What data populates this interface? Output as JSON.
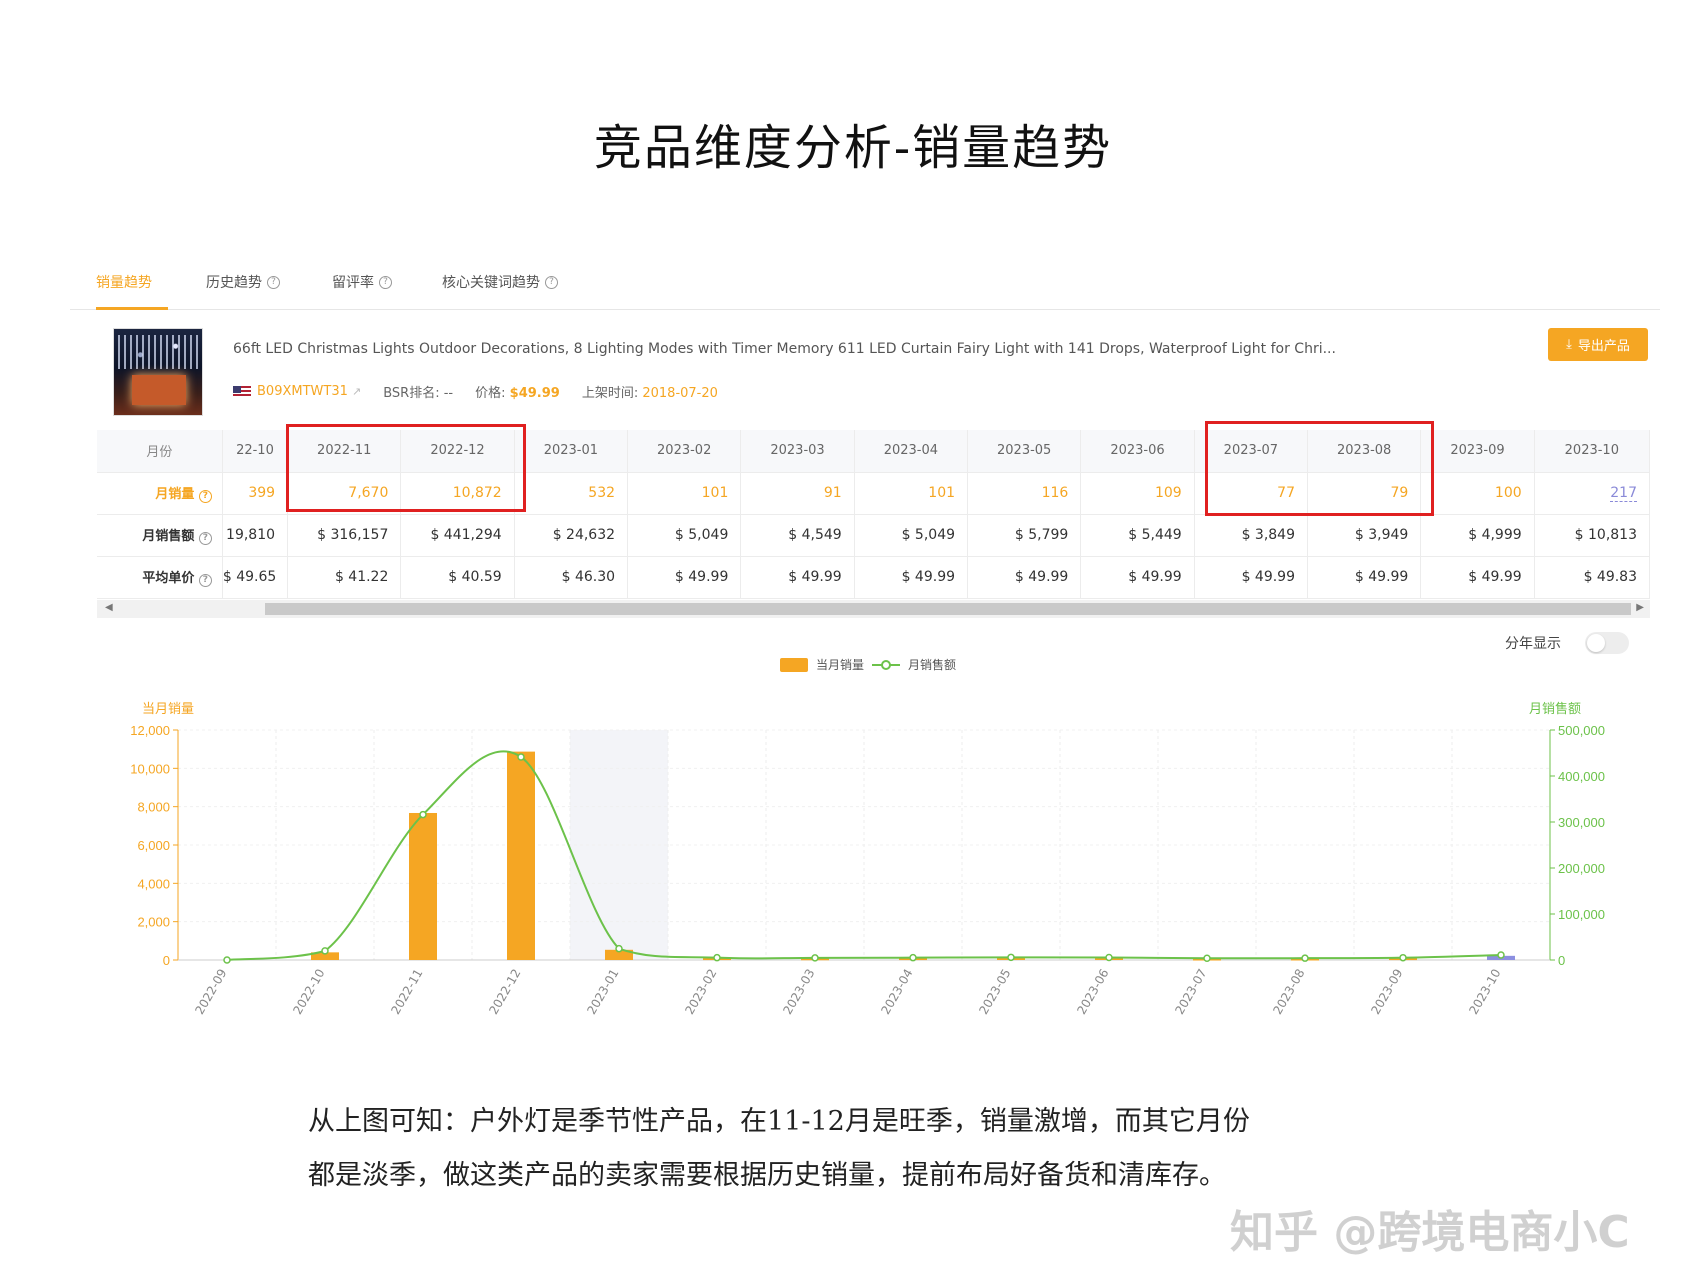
{
  "page_title": "竞品维度分析-销量趋势",
  "tabs": [
    {
      "label": "销量趋势"
    },
    {
      "label": "历史趋势"
    },
    {
      "label": "留评率"
    },
    {
      "label": "核心关键词趋势"
    }
  ],
  "product": {
    "title": "66ft LED Christmas Lights Outdoor Decorations, 8 Lighting Modes with Timer Memory 611 LED Curtain Fairy Light with 141 Drops, Waterproof Light for Chri...",
    "asin": "B09XMTWT31",
    "bsr_label": "BSR排名:",
    "bsr_value": "--",
    "price_label": "价格:",
    "price_value": "$49.99",
    "listed_label": "上架时间:",
    "listed_value": "2018-07-20",
    "export_label": "导出产品"
  },
  "table": {
    "row_labels": {
      "month": "月份",
      "sales": "月销量",
      "revenue": "月销售额",
      "avg_price": "平均单价"
    },
    "months": [
      "22-10",
      "2022-11",
      "2022-12",
      "2023-01",
      "2023-02",
      "2023-03",
      "2023-04",
      "2023-05",
      "2023-06",
      "2023-07",
      "2023-08",
      "2023-09",
      "2023-10"
    ],
    "sales": [
      "399",
      "7,670",
      "10,872",
      "532",
      "101",
      "91",
      "101",
      "116",
      "109",
      "77",
      "79",
      "100",
      "217"
    ],
    "revenue": [
      "19,810",
      "$ 316,157",
      "$ 441,294",
      "$ 24,632",
      "$ 5,049",
      "$ 4,549",
      "$ 5,049",
      "$ 5,799",
      "$ 5,449",
      "$ 3,849",
      "$ 3,949",
      "$ 4,999",
      "$ 10,813"
    ],
    "avg_price": [
      "$ 49.65",
      "$ 41.22",
      "$ 40.59",
      "$ 46.30",
      "$ 49.99",
      "$ 49.99",
      "$ 49.99",
      "$ 49.99",
      "$ 49.99",
      "$ 49.99",
      "$ 49.99",
      "$ 49.99",
      "$ 49.83"
    ]
  },
  "toggle_label": "分年显示",
  "chart_data": {
    "type": "bar",
    "categories": [
      "2022-09",
      "2022-10",
      "2022-11",
      "2022-12",
      "2023-01",
      "2023-02",
      "2023-03",
      "2023-04",
      "2023-05",
      "2023-06",
      "2023-07",
      "2023-08",
      "2023-09",
      "2023-10"
    ],
    "series": [
      {
        "name": "当月销量",
        "type": "bar",
        "axis": "left",
        "color": "#f5a623",
        "values": [
          0,
          399,
          7670,
          10872,
          532,
          101,
          91,
          101,
          116,
          109,
          77,
          79,
          100,
          217
        ]
      },
      {
        "name": "月销售额",
        "type": "line",
        "axis": "right",
        "color": "#6cc24a",
        "values": [
          0,
          19810,
          316157,
          441294,
          24632,
          5049,
          4549,
          5049,
          5799,
          5449,
          3849,
          3949,
          4999,
          10813
        ]
      }
    ],
    "ylabel_left": "当月销量",
    "ylabel_right": "月销售额",
    "ylim_left": [
      0,
      12000
    ],
    "ylim_right": [
      0,
      500000
    ],
    "yticks_left": [
      "12,000",
      "10,000",
      "8,000",
      "6,000",
      "4,000",
      "2,000",
      "0"
    ],
    "yticks_right": [
      "500,000",
      "400,000",
      "300,000",
      "200,000",
      "100,000",
      "0"
    ],
    "highlighted_category": "2023-01",
    "grid": true,
    "legend_position": "top-center"
  },
  "description": {
    "line1": "从上图可知：户外灯是季节性产品，在11-12月是旺季，销量激增，而其它月份",
    "line2": "都是淡季，做这类产品的卖家需要根据历史销量，提前布局好备货和清库存。"
  },
  "watermark": "知乎 @跨境电商小C"
}
